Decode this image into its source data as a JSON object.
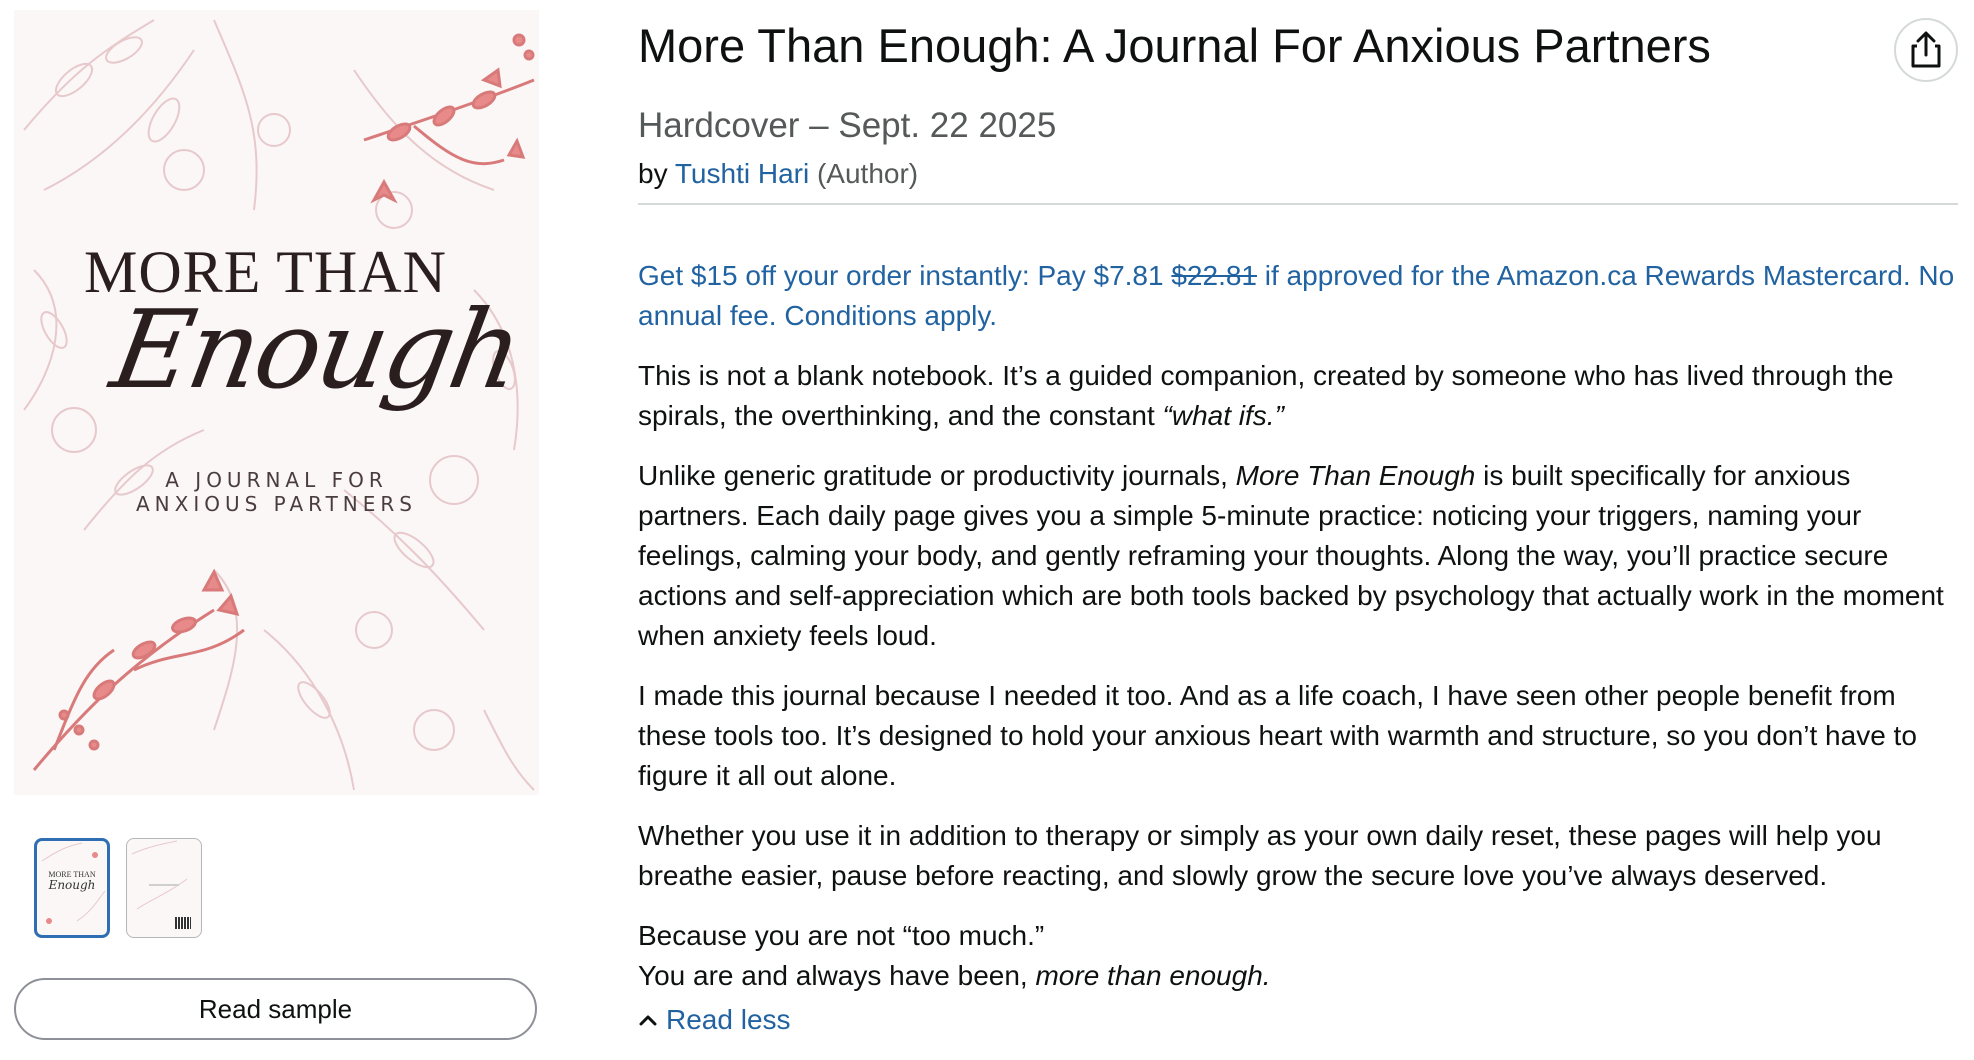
{
  "product": {
    "title": "More Than Enough: A Journal For Anxious Partners",
    "format": "Hardcover – Sept. 22 2025",
    "by": "by",
    "author": "Tushti Hari",
    "author_role": "(Author)"
  },
  "cover": {
    "title_line1": "MORE THAN",
    "title_script": "Enough",
    "subtitle_line1": "A JOURNAL FOR",
    "subtitle_line2": "ANXIOUS PARTNERS",
    "accent_color": "#e98a8a",
    "line_color": "#e7c9cc"
  },
  "gallery": {
    "read_sample_label": "Read sample"
  },
  "promo": {
    "part1": "Get $15 off your order instantly: Pay $7.81 ",
    "old_price": "$22.81",
    "part2": " if approved for the Amazon.ca Rewards Mastercard. No annual fee. Conditions apply."
  },
  "description": {
    "p1_text": "This is not a blank notebook. It’s a guided companion, created by someone who has lived through the spirals, the overthinking, and the constant ",
    "p1_italic": "“what ifs.”",
    "p2_start": "Unlike generic gratitude or productivity journals, ",
    "p2_italic": "More Than Enough",
    "p2_rest": " is built specifically for anxious partners. Each daily page gives you a simple 5-minute practice: noticing your triggers, naming your feelings, calming your body, and gently reframing your thoughts. Along the way, you’ll practice secure actions and self-appreciation which are both tools backed by psychology that actually work in the moment when anxiety feels loud.",
    "p3": "I made this journal because I needed it too. And as a life coach, I have seen other people benefit from these tools too. It’s designed to hold your anxious heart with warmth and structure, so you don’t have to figure it all out alone.",
    "p4": "Whether you use it in addition to therapy or simply as your own daily reset, these pages will help you breathe easier, pause before reacting, and slowly grow the secure love you’ve always deserved.",
    "p5_line1": "Because you are not “too much.”",
    "p5_line2_start": "You are and always have been, ",
    "p5_line2_italic": "more than enough."
  },
  "read_less_label": "Read less",
  "colors": {
    "link": "#2162a1",
    "text": "#0f1111",
    "muted": "#565959"
  }
}
